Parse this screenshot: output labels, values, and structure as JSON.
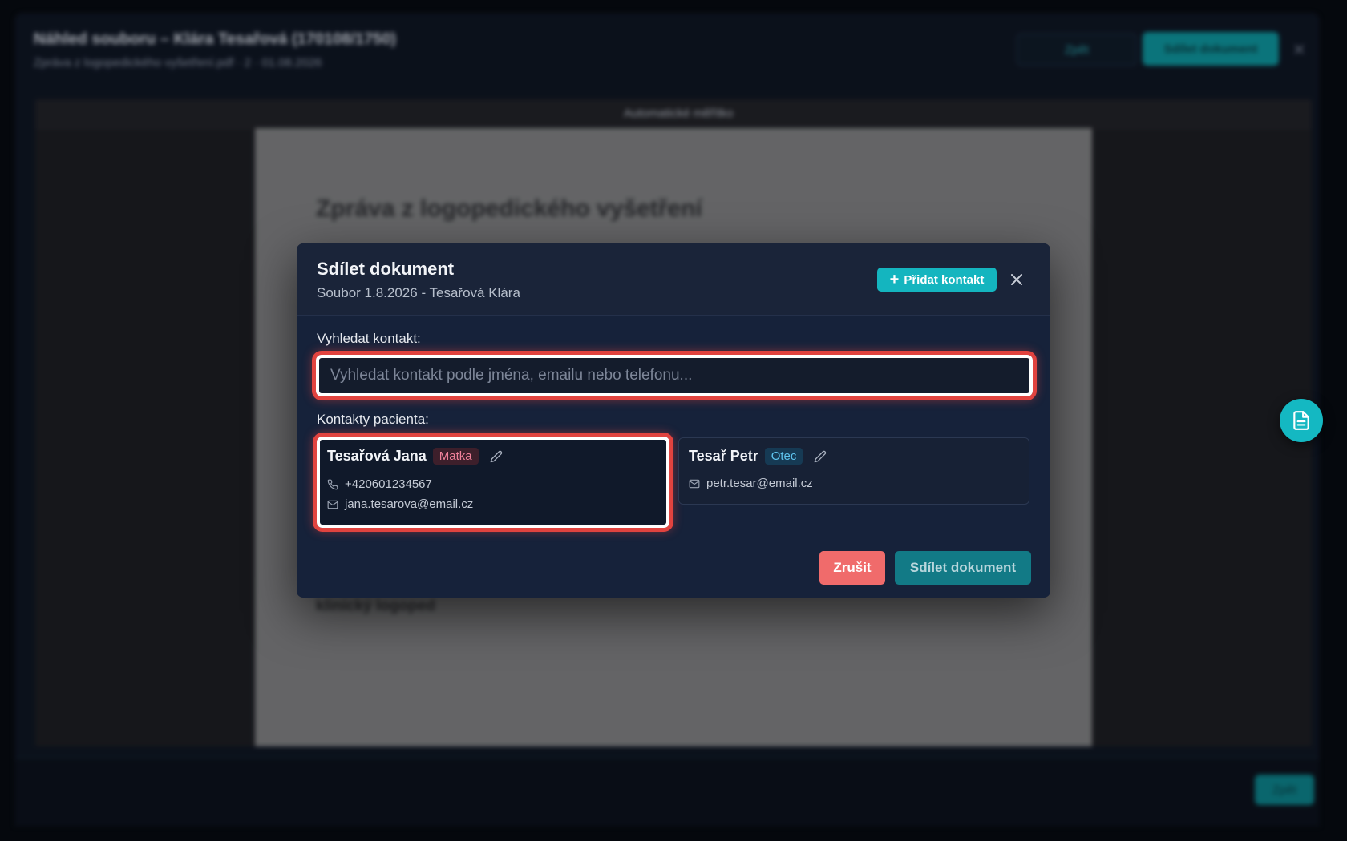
{
  "background": {
    "window_title": "Náhled souboru – Klára Tesařová (170108/1750)",
    "file_info": "Zpráva z logopedického vyšetření.pdf · 2 · 01.08.2026",
    "back_button": "Zpět",
    "share_button": "Sdílet dokument",
    "toolbar_label": "Automatické měřítko",
    "document_heading": "Zpráva z logopedického vyšetření",
    "document_signature": "klinický logoped",
    "footer_button": "Zpět"
  },
  "modal": {
    "title": "Sdílet dokument",
    "subtitle": "Soubor 1.8.2026 - Tesařová Klára",
    "add_contact_label": "Přidat kontakt",
    "search_label": "Vyhledat kontakt:",
    "search_placeholder": "Vyhledat kontakt podle jména, emailu nebo telefonu...",
    "contacts_label": "Kontakty pacienta:",
    "contacts": [
      {
        "name": "Tesařová Jana",
        "role": "Matka",
        "phone": "+420601234567",
        "email": "jana.tesarova@email.cz",
        "selected": true
      },
      {
        "name": "Tesař Petr",
        "role": "Otec",
        "email": "petr.tesar@email.cz",
        "selected": false
      }
    ],
    "cancel_label": "Zrušit",
    "share_label": "Sdílet dokument"
  },
  "colors": {
    "accent": "#14b5bf",
    "danger": "#f06b6b",
    "highlight": "#e1433f",
    "modal_bg": "#16223a"
  },
  "icons": {
    "add": "plus-icon",
    "close": "close-icon",
    "edit": "pencil-icon",
    "phone": "phone-icon",
    "email": "mail-icon",
    "fab": "document-icon"
  }
}
